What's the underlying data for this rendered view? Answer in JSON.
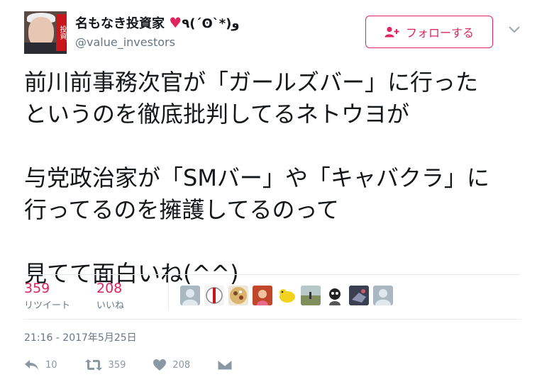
{
  "profile": {
    "name": "名もなき投資家",
    "heart": "♥",
    "emoticon": "٩(´ʘ`*)و",
    "handle": "@value_investors",
    "avatar_stamp": "投資"
  },
  "follow_button": {
    "label": "フォローする"
  },
  "tweet": {
    "paragraph1": [
      "前川前事務次官が「ガールズバー」に行った",
      "というのを徹底批判してるネトウヨが"
    ],
    "paragraph2": [
      "与党政治家が「SMバー」や「キャバクラ」に",
      "行ってるのを擁護してるのって"
    ],
    "paragraph3": [
      "見てて面白いね(^^)"
    ]
  },
  "stats": {
    "retweets": {
      "count": "359",
      "label": "リツイート"
    },
    "likes": {
      "count": "208",
      "label": "いいね"
    }
  },
  "timestamp": "21:16 - 2017年5月25日",
  "actions": {
    "reply_count": "10",
    "retweet_count": "359",
    "like_count": "208"
  },
  "colors": {
    "accent": "#e0245e",
    "muted": "#657786",
    "icon": "#8a98a5",
    "divider": "#e6ecf0"
  }
}
